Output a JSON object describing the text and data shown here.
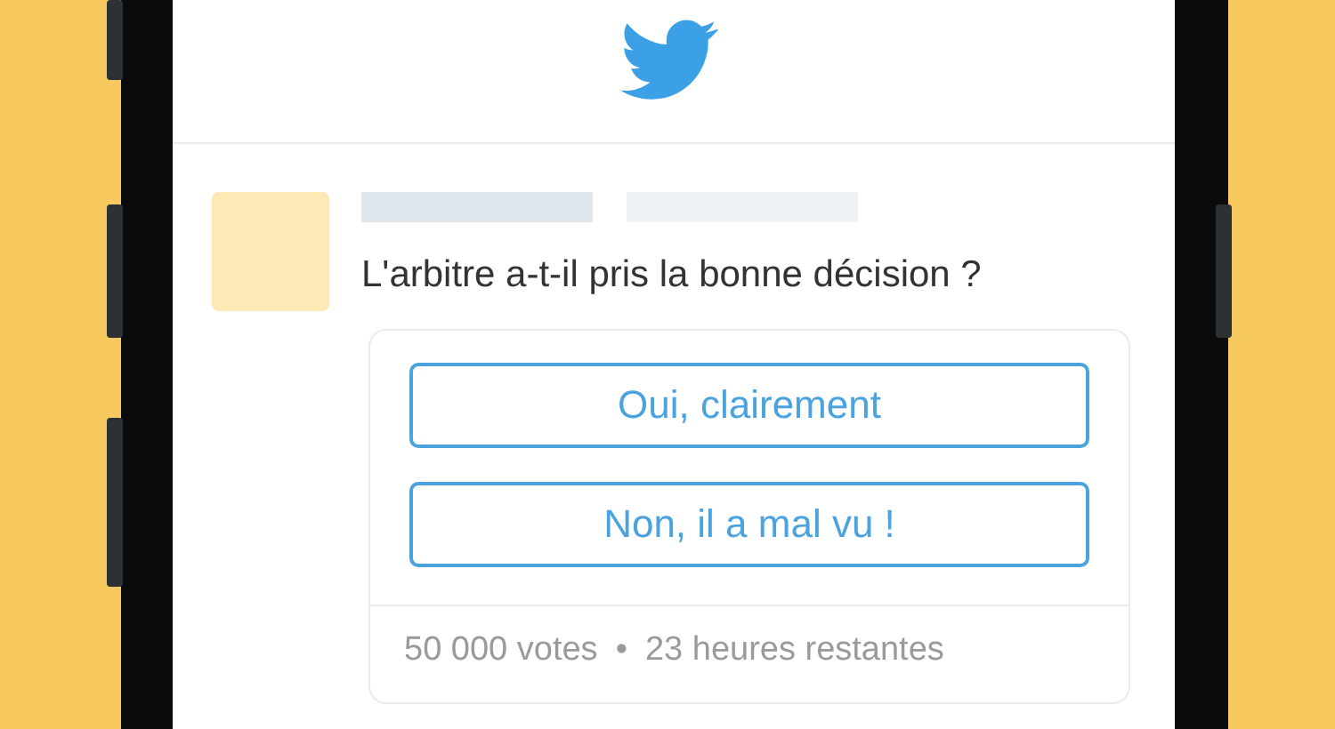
{
  "tweet": {
    "question": "L'arbitre a-t-il pris la bonne décision ?",
    "poll": {
      "options": [
        {
          "label": "Oui, clairement"
        },
        {
          "label": "Non, il a mal vu !"
        }
      ],
      "votes": "50 000 votes",
      "separator": "•",
      "time_left": "23 heures restantes"
    }
  }
}
